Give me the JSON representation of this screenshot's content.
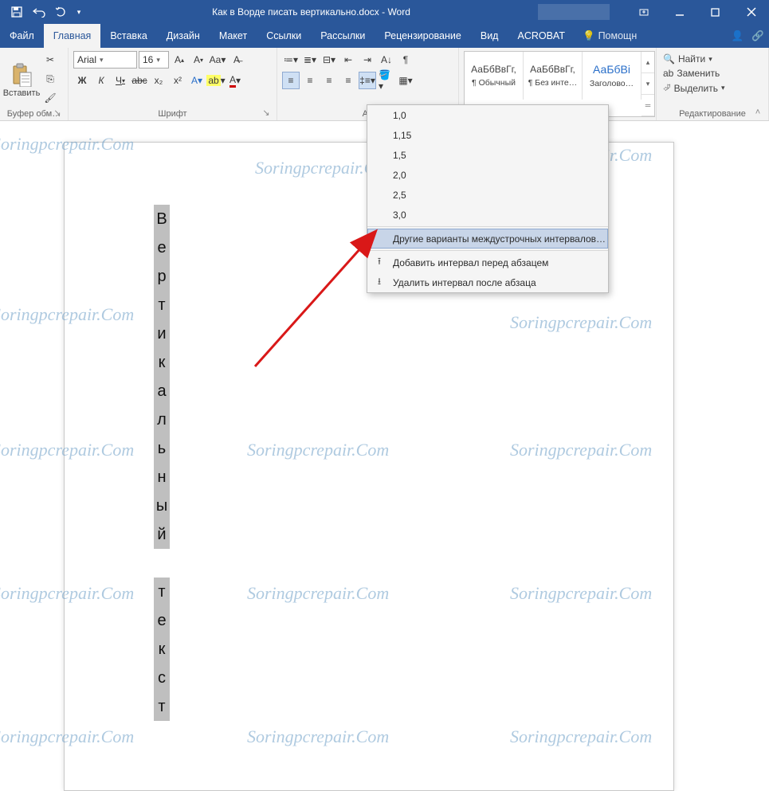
{
  "titlebar": {
    "doc_title": "Как в Ворде писать вертикально.docx - Word"
  },
  "qat": {
    "save": "save-icon",
    "undo": "undo-icon",
    "redo": "redo-icon",
    "customize": "customize-qat"
  },
  "tabs": {
    "file": "Файл",
    "home": "Главная",
    "insert": "Вставка",
    "design": "Дизайн",
    "layout": "Макет",
    "references": "Ссылки",
    "mailings": "Рассылки",
    "review": "Рецензирование",
    "view": "Вид",
    "acrobat": "ACROBAT",
    "tellme": "Помощн"
  },
  "ribbon": {
    "clipboard": {
      "paste": "Вставить",
      "label": "Буфер обм…"
    },
    "font": {
      "name": "Arial",
      "size": "16",
      "label": "Шрифт",
      "bold": "Ж",
      "italic": "К",
      "underline": "Ч",
      "strike": "abc",
      "sub": "x₂",
      "sup": "x²"
    },
    "paragraph": {
      "label": "Аб"
    },
    "styles": {
      "s1_preview": "АаБбВвГг,",
      "s1_name": "¶ Обычный",
      "s2_preview": "АаБбВвГг,",
      "s2_name": "¶ Без инте…",
      "s3_preview": "АаБбВі",
      "s3_name": "Заголово…"
    },
    "editing": {
      "find": "Найти",
      "replace": "Заменить",
      "select": "Выделить",
      "label": "Редактирование"
    }
  },
  "dropdown": {
    "o1": "1,0",
    "o2": "1,15",
    "o3": "1,5",
    "o4": "2,0",
    "o5": "2,5",
    "o6": "3,0",
    "other": "Другие варианты междустрочных интервалов…",
    "add_before": "Добавить интервал перед абзацем",
    "remove_after": "Удалить интервал после абзаца"
  },
  "document": {
    "chars": [
      "В",
      "е",
      "р",
      "т",
      "и",
      "к",
      "а",
      "л",
      "ь",
      "н",
      "ы",
      "й",
      "",
      "т",
      "е",
      "к",
      "с",
      "т"
    ]
  },
  "watermark": "Soringpcrepair.Com"
}
